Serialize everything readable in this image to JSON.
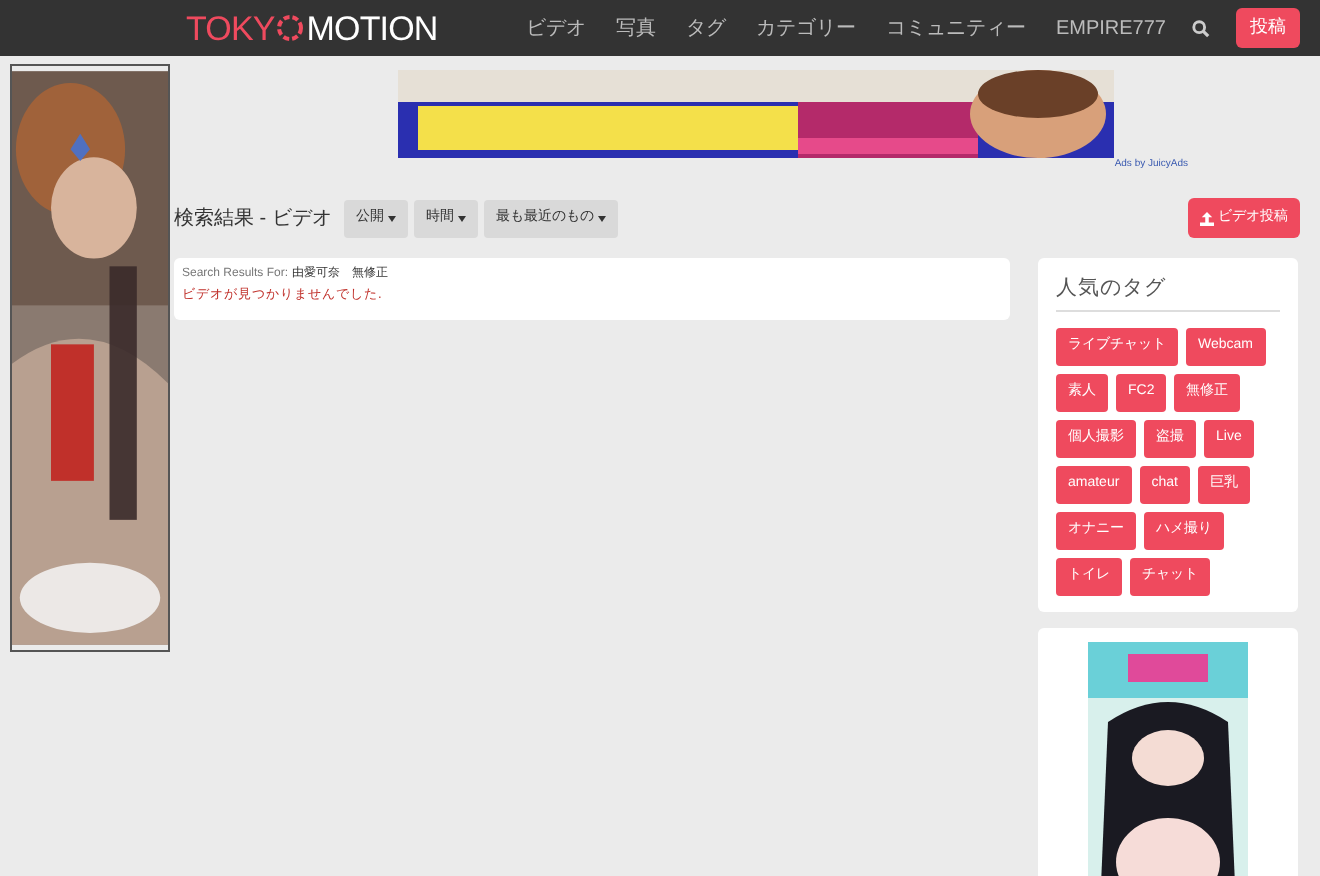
{
  "header": {
    "logo_left": "TOKY",
    "logo_right": "MOTION",
    "nav": [
      "ビデオ",
      "写真",
      "タグ",
      "カテゴリー",
      "コミュニティー",
      "EMPIRE777"
    ],
    "post_button": "投稿"
  },
  "ad_credit": "Ads by JuicyAds",
  "toolbar": {
    "title": "検索結果 - ビデオ",
    "filters": [
      "公開",
      "時間",
      "最も最近のもの"
    ],
    "upload_button": "ビデオ投稿"
  },
  "results": {
    "query_label": "Search Results For:",
    "query": "由愛可奈　無修正",
    "message": "ビデオが見つかりませんでした."
  },
  "tags_panel": {
    "title": "人気のタグ",
    "tags": [
      [
        "ライブチャット",
        "Webcam"
      ],
      [
        "素人",
        "FC2",
        "無修正"
      ],
      [
        "個人撮影",
        "盗撮",
        "Live"
      ],
      [
        "amateur",
        "chat",
        "巨乳"
      ],
      [
        "オナニー",
        "ハメ撮り"
      ],
      [
        "トイレ",
        "チャット"
      ]
    ]
  }
}
